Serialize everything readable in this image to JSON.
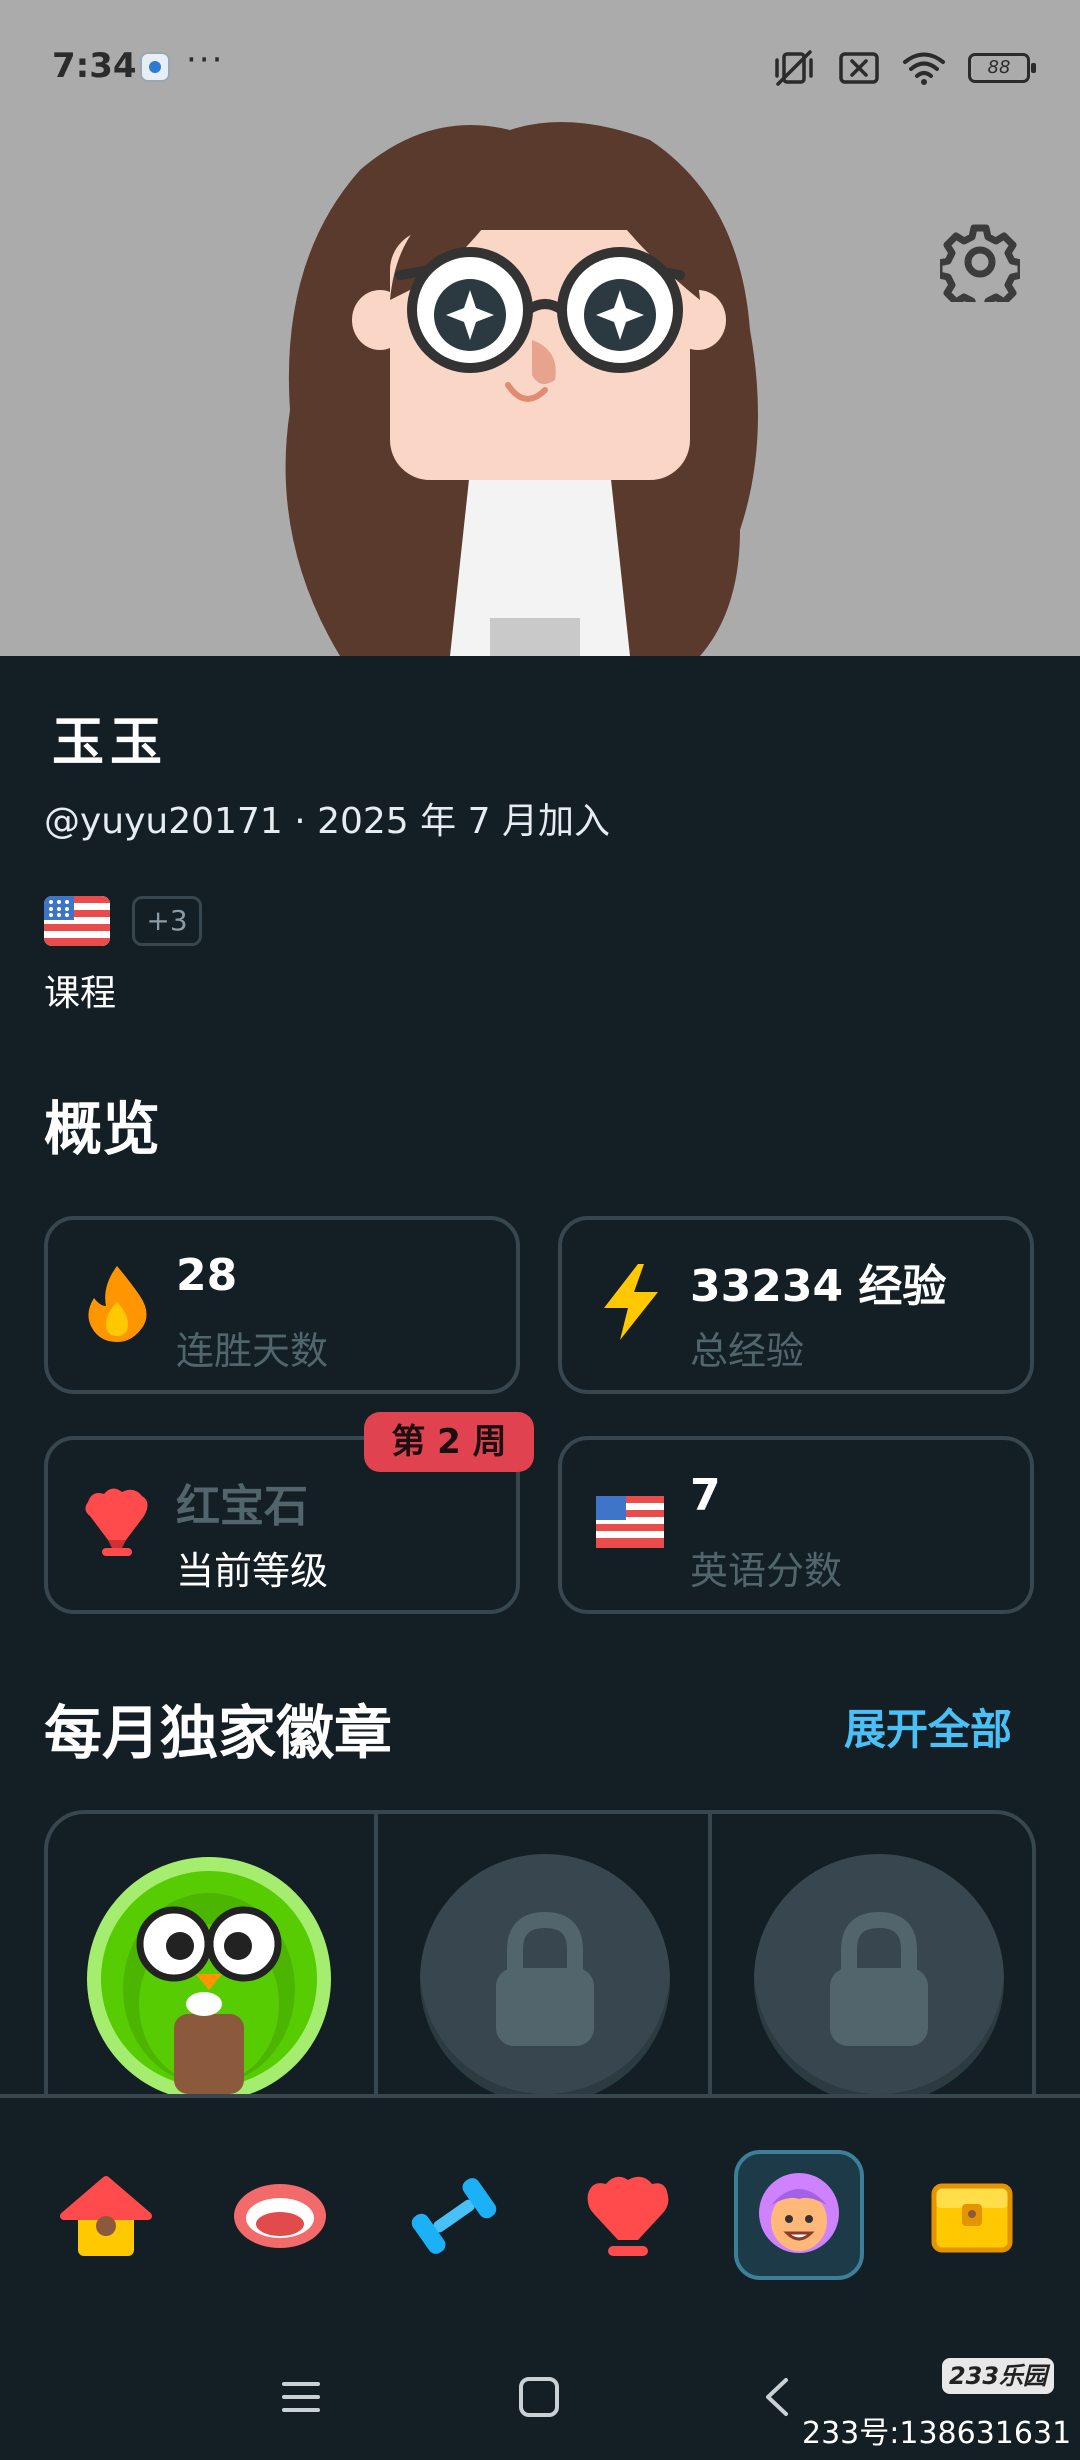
{
  "status_bar": {
    "time": "7:34",
    "more": "···",
    "battery": "88",
    "icons": [
      "app-notification-icon",
      "vibrate-off-icon",
      "no-sim-icon",
      "wifi-icon",
      "battery-icon"
    ]
  },
  "header": {
    "settings_icon": "gear-icon"
  },
  "profile": {
    "name": "玉玉",
    "handle_line": "@yuyu20171 · 2025 年 7 月加入",
    "extra_courses": "+3",
    "courses_label": "课程"
  },
  "overview": {
    "title": "概览",
    "cards": [
      {
        "value": "28",
        "label": "连胜天数",
        "icon": "flame-icon"
      },
      {
        "value": "33234 经验",
        "label": "总经验",
        "icon": "lightning-icon"
      },
      {
        "value": "红宝石",
        "label": "当前等级",
        "icon": "ruby-league-icon",
        "badge": "第 2 周"
      },
      {
        "value": "7",
        "label": "英语分数",
        "icon": "us-flag-icon"
      }
    ]
  },
  "monthly_badges": {
    "title": "每月独家徽章",
    "expand_label": "展开全部",
    "slots": [
      "owl-badge",
      "locked",
      "locked"
    ]
  },
  "bottom_nav": {
    "items": [
      "home-icon",
      "speaking-icon",
      "practice-icon",
      "leagues-icon",
      "profile-icon",
      "shop-chest-icon"
    ],
    "active_index": 4
  },
  "watermark": {
    "logo": "233乐园",
    "text": "233号:138631631"
  },
  "colors": {
    "background": "#131f24",
    "hero_background": "#acabab",
    "card_border": "#37464f",
    "muted_text": "#52656d",
    "link_blue": "#49c0f8",
    "week_badge_red": "#e0424f"
  }
}
